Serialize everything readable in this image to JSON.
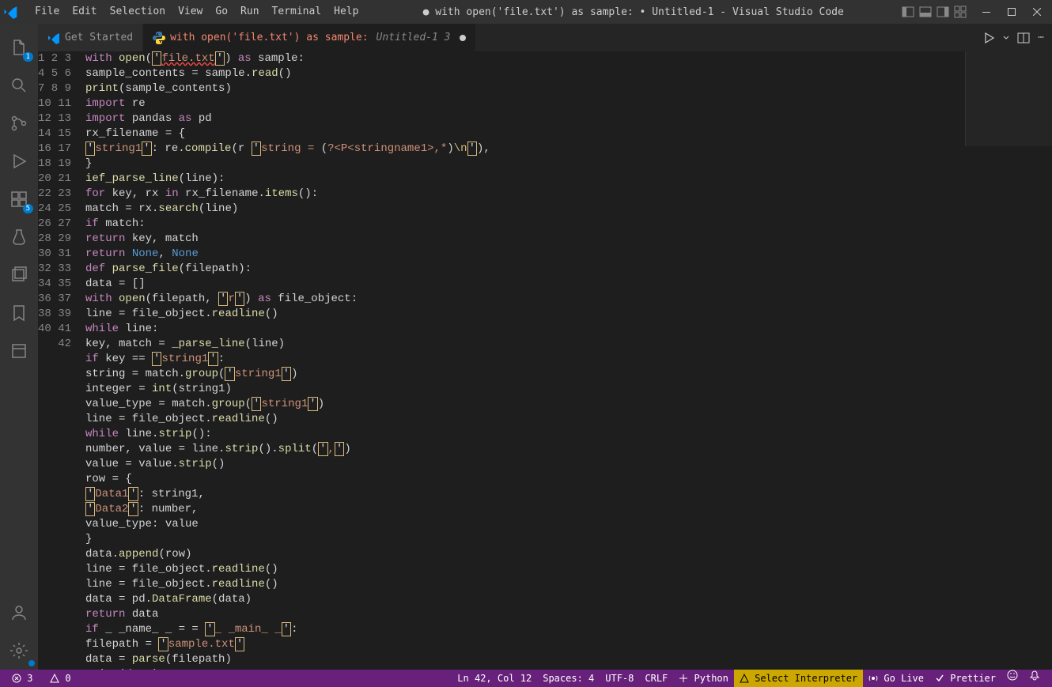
{
  "menubar": {
    "items": [
      "File",
      "Edit",
      "Selection",
      "View",
      "Go",
      "Run",
      "Terminal",
      "Help"
    ],
    "title": "● with open('file.txt') as sample: • Untitled-1 - Visual Studio Code"
  },
  "tabs": [
    {
      "label": "Get Started",
      "icon": "vscode",
      "active": false,
      "modified": false,
      "suffix": ""
    },
    {
      "label": "with open('file.txt') as sample:",
      "icon": "python",
      "active": true,
      "modified": true,
      "suffix": "Untitled-1 3"
    }
  ],
  "activitybar": {
    "explorer_badge": "1",
    "extensions_badge": "5"
  },
  "code_lines": [
    "with open('file.txt') as sample:",
    "sample_contents = sample.read()",
    "print(sample_contents)",
    "import re",
    "import pandas as pd",
    "rx_filename = {",
    "'string1': re.compile(r 'string = (?<P<stringname1>,*)\\n'),",
    "}",
    "ief_parse_line(line):",
    "for key, rx in rx_filename.items():",
    "match = rx.search(line)",
    "if match:",
    "return key, match",
    "return None, None",
    "def parse_file(filepath):",
    "data = []",
    "with open(filepath, 'r') as file_object:",
    "line = file_object.readline()",
    "while line:",
    "key, match = _parse_line(line)",
    "if key == 'string1':",
    "string = match.group('string1')",
    "integer = int(string1)",
    "value_type = match.group('string1')",
    "line = file_object.readline()",
    "while line.strip():",
    "number, value = line.strip().split(',')",
    "value = value.strip()",
    "row = {",
    "'Data1': string1,",
    "'Data2': number,",
    "value_type: value",
    "}",
    "data.append(row)",
    "line = file_object.readline()",
    "line = file_object.readline()",
    "data = pd.DataFrame(data)",
    "return data",
    "if _ _name_ _ = = '_ _main_ _':",
    "filepath = 'sample.txt'",
    "data = parse(filepath)",
    "print(data)"
  ],
  "statusbar": {
    "errors": "3",
    "warnings": "0",
    "lncol": "Ln 42, Col 12",
    "spaces": "Spaces: 4",
    "encoding": "UTF-8",
    "eol": "CRLF",
    "lang": "Python",
    "interp": "Select Interpreter",
    "golive": "Go Live",
    "prettier": "Prettier"
  }
}
